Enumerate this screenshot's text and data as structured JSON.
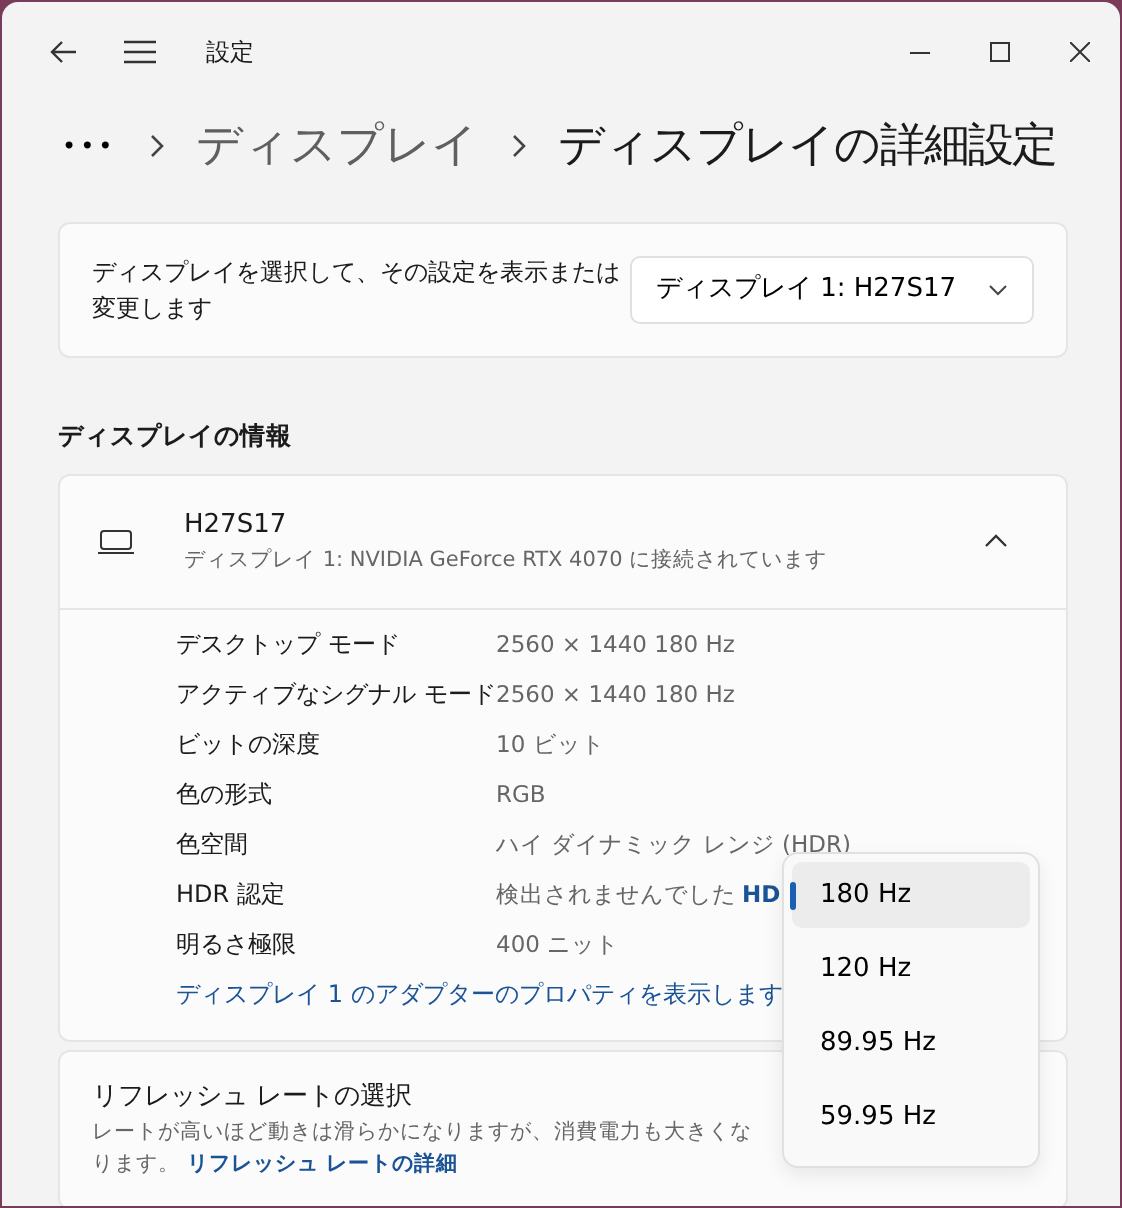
{
  "window": {
    "title": "設定"
  },
  "breadcrumb": {
    "more": "•••",
    "items": [
      {
        "label": "ディスプレイ",
        "current": false
      },
      {
        "label": "ディスプレイの詳細設定",
        "current": true
      }
    ]
  },
  "display_select": {
    "label": "ディスプレイを選択して、その設定を表示または変更します",
    "value": "ディスプレイ 1: H27S17"
  },
  "section_title": "ディスプレイの情報",
  "display_info": {
    "name": "H27S17",
    "subtitle": "ディスプレイ 1: NVIDIA GeForce RTX 4070 に接続されています",
    "expanded": true,
    "rows": [
      {
        "label": "デスクトップ モード",
        "value": "2560 × 1440 180 Hz"
      },
      {
        "label": "アクティブなシグナル モード",
        "value": "2560 × 1440 180 Hz"
      },
      {
        "label": "ビットの深度",
        "value": "10 ビット"
      },
      {
        "label": "色の形式",
        "value": "RGB"
      },
      {
        "label": "色空間",
        "value": "ハイ ダイナミック レンジ (HDR)"
      },
      {
        "label": "HDR 認定",
        "value": "検出されませんでした",
        "link": "HD"
      },
      {
        "label": "明るさ極限",
        "value": "400 ニット"
      }
    ],
    "adapter_link": "ディスプレイ 1 のアダプターのプロパティを表示します"
  },
  "refresh": {
    "title": "リフレッシュ レートの選択",
    "description": "レートが高いほど動きは滑らかになりますが、消費電力も大きくなります。",
    "link": "リフレッシュ レートの詳細"
  },
  "refresh_menu": [
    {
      "label": "180 Hz",
      "selected": true
    },
    {
      "label": "120 Hz",
      "selected": false
    },
    {
      "label": "89.95 Hz",
      "selected": false
    },
    {
      "label": "59.95 Hz",
      "selected": false
    }
  ]
}
